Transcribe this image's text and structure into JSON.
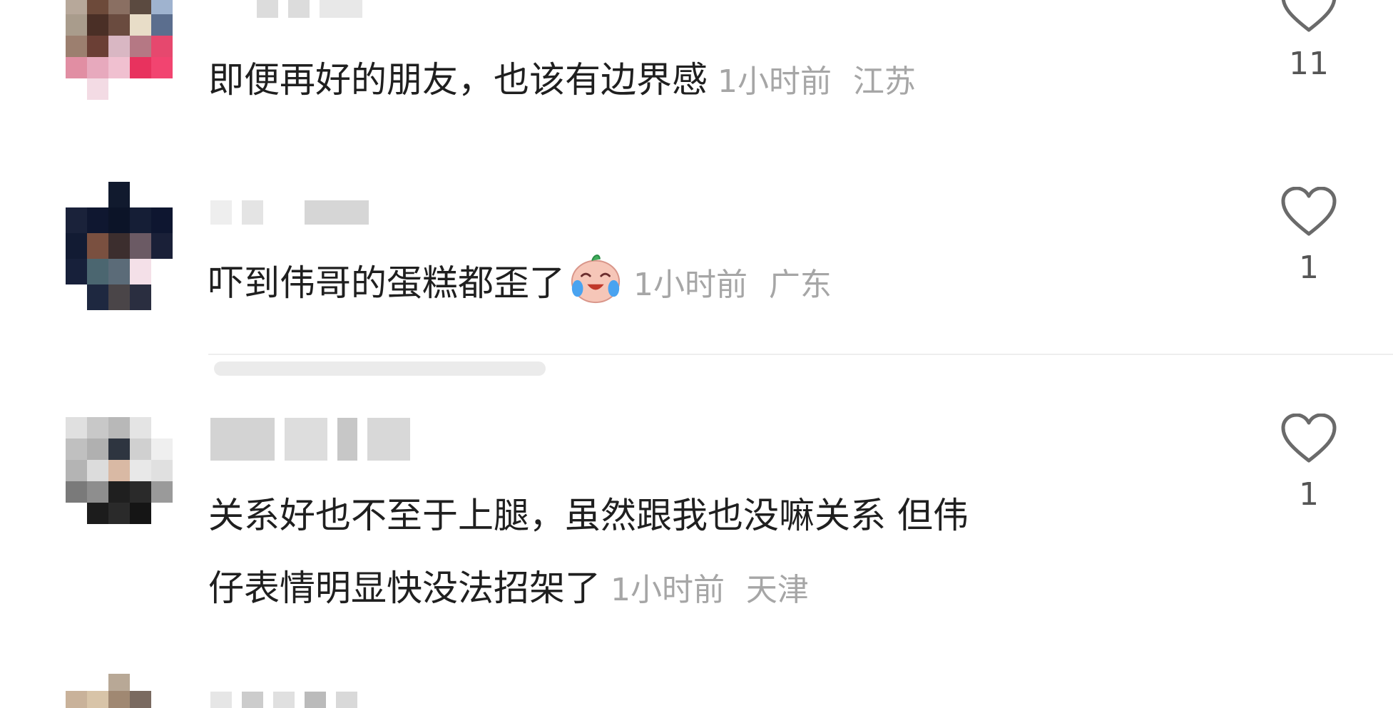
{
  "comments": [
    {
      "text": "即便再好的朋友，也该有边界感",
      "time": "1小时前",
      "location": "江苏",
      "likes": "11"
    },
    {
      "text": "吓到伟哥的蛋糕都歪了",
      "emoji": "crying-laughing-face-emoji",
      "time": "1小时前",
      "location": "广东",
      "likes": "1"
    },
    {
      "text_line1": "关系好也不至于上腿，虽然跟我也没嘛关系 但伟",
      "text_line2": "仔表情明显快没法招架了",
      "time": "1小时前",
      "location": "天津",
      "likes": "1"
    }
  ],
  "icons": {
    "like": "heart-outline-icon"
  },
  "colors": {
    "text": "#1f1f1f",
    "meta": "#a6a6a6",
    "count": "#555555"
  }
}
